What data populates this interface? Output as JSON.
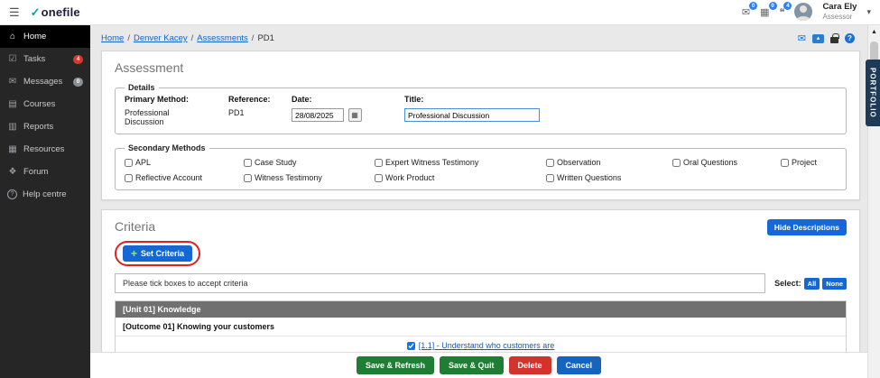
{
  "topbar": {
    "menu_glyph": "☰",
    "logo_check": "✓",
    "logo_text": "onefile",
    "icons": {
      "mail": {
        "glyph": "✉",
        "badge": "0"
      },
      "calendar": {
        "glyph": "▦",
        "badge": "0"
      },
      "chat": {
        "glyph": "❝",
        "badge": "4"
      }
    },
    "user": {
      "name": "Cara Ely",
      "role": "Assessor",
      "chevron": "▾"
    }
  },
  "sidebar": {
    "items": [
      {
        "icon": "home-icon",
        "glyph": "⌂",
        "label": "Home"
      },
      {
        "icon": "tasks-icon",
        "glyph": "☑",
        "label": "Tasks",
        "badge": "4"
      },
      {
        "icon": "messages-icon",
        "glyph": "✉",
        "label": "Messages",
        "badge": "0"
      },
      {
        "icon": "courses-icon",
        "glyph": "▤",
        "label": "Courses"
      },
      {
        "icon": "reports-icon",
        "glyph": "▥",
        "label": "Reports"
      },
      {
        "icon": "resources-icon",
        "glyph": "▦",
        "label": "Resources"
      },
      {
        "icon": "forum-icon",
        "glyph": "❖",
        "label": "Forum"
      },
      {
        "icon": "help-icon",
        "glyph": "?",
        "label": "Help centre"
      }
    ]
  },
  "breadcrumb": {
    "separator": "/",
    "links": [
      "Home",
      "Denver Kacey",
      "Assessments"
    ],
    "current": "PD1"
  },
  "page_icons": {
    "mail_glyph": "✉",
    "gallery_glyph": "▴",
    "help_glyph": "?"
  },
  "portfolio_tab": "PORTFOLIO",
  "scrollbar": {
    "up_arrow": "▲"
  },
  "assessment": {
    "title": "Assessment",
    "details": {
      "legend": "Details",
      "primary_method_label": "Primary Method:",
      "primary_method_value": "Professional Discussion",
      "reference_label": "Reference:",
      "reference_value": "PD1",
      "date_label": "Date:",
      "date_value": "28/08/2025",
      "calendar_glyph": "▦",
      "title_label": "Title:",
      "title_value": "Professional Discussion"
    },
    "secondary_methods": {
      "legend": "Secondary Methods",
      "row1": [
        "APL",
        "Case Study",
        "Expert Witness Testimony",
        "Observation",
        "Oral Questions",
        "Project"
      ],
      "row2": [
        "Reflective Account",
        "Witness Testimony",
        "Work Product",
        "Written Questions"
      ]
    }
  },
  "criteria": {
    "title": "Criteria",
    "hide_descriptions_label": "Hide Descriptions",
    "plus_glyph": "+",
    "set_criteria_label": "Set Criteria",
    "instruction": "Please tick boxes to accept criteria",
    "select_label": "Select:",
    "all_label": "All",
    "none_label": "None",
    "unit_header": "[Unit 01] Knowledge",
    "outcome_header": "[Outcome 01] Knowing your customers",
    "criterion_label": "[1.1] - Understand who customers are"
  },
  "footer": {
    "save_refresh": "Save & Refresh",
    "save_quit": "Save & Quit",
    "delete": "Delete",
    "cancel": "Cancel"
  }
}
